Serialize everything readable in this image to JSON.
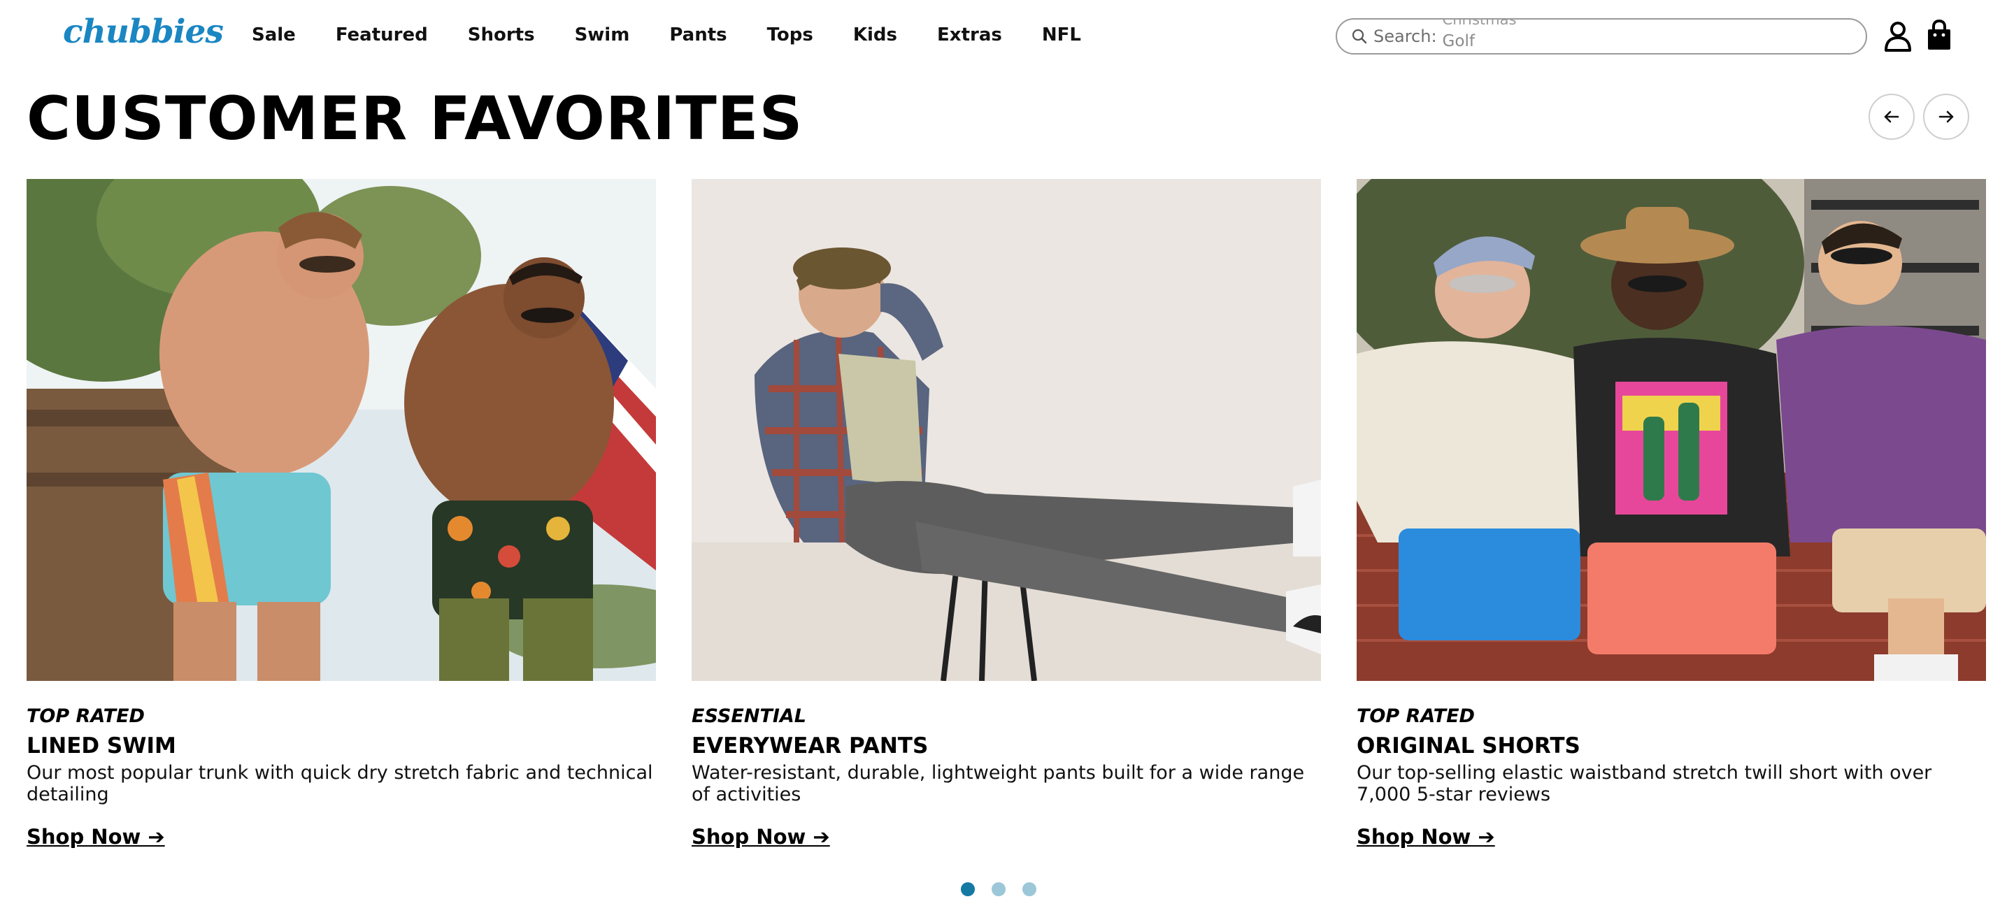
{
  "header": {
    "logo_text": "chubbies",
    "nav": [
      "Sale",
      "Featured",
      "Shorts",
      "Swim",
      "Pants",
      "Tops",
      "Kids",
      "Extras",
      "NFL"
    ],
    "search": {
      "label": "Search:",
      "rotating_prev": "Christmas",
      "rotating_current": "Golf"
    },
    "icons": {
      "search": "search-icon",
      "account": "user-icon",
      "cart": "shopping-bag-icon"
    }
  },
  "section": {
    "title": "CUSTOMER FAVORITES",
    "prev_icon": "arrow-left-icon",
    "next_icon": "arrow-right-icon"
  },
  "cards": [
    {
      "eyebrow": "TOP RATED",
      "title": "LINED SWIM",
      "description": "Our most popular trunk with quick dry stretch fabric and technical detailing",
      "link": "Shop Now ➔"
    },
    {
      "eyebrow": "ESSENTIAL",
      "title": "EVERYWEAR PANTS",
      "description": "Water-resistant, durable, lightweight pants built for a wide range of activities",
      "link": "Shop Now ➔"
    },
    {
      "eyebrow": "TOP RATED",
      "title": "ORIGINAL SHORTS",
      "description": "Our top-selling elastic waistband stretch twill short with over 7,000 5-star reviews",
      "link": "Shop Now ➔"
    }
  ],
  "pagination": {
    "active_index": 0,
    "count": 3
  },
  "colors": {
    "brand_blue": "#1a86c2",
    "dot_active": "#1479a3",
    "dot_inactive": "#9cc7d8",
    "border": "#9a9a9a"
  }
}
